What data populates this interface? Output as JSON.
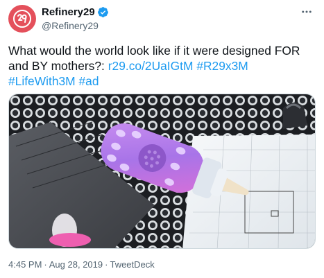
{
  "tweet": {
    "display_name": "Refinery29",
    "handle": "@Refinery29",
    "text_plain": "What would the world look like if it were designed FOR and BY mothers?: ",
    "links": [
      "r29.co/2UaIGtM",
      "#R29x3M",
      "#LifeWith3M",
      "#ad"
    ],
    "time": "4:45 PM",
    "date": "Aug 28, 2019",
    "source": "TweetDeck",
    "separator": "·"
  },
  "icons": {
    "avatar": "refinery29-logo",
    "verified": "verified-badge-icon",
    "more": "more-options-icon"
  },
  "colors": {
    "brand": "#e4505b",
    "link": "#1d9bf0",
    "verified": "#1d9bf0",
    "secondary_text": "#536471"
  }
}
